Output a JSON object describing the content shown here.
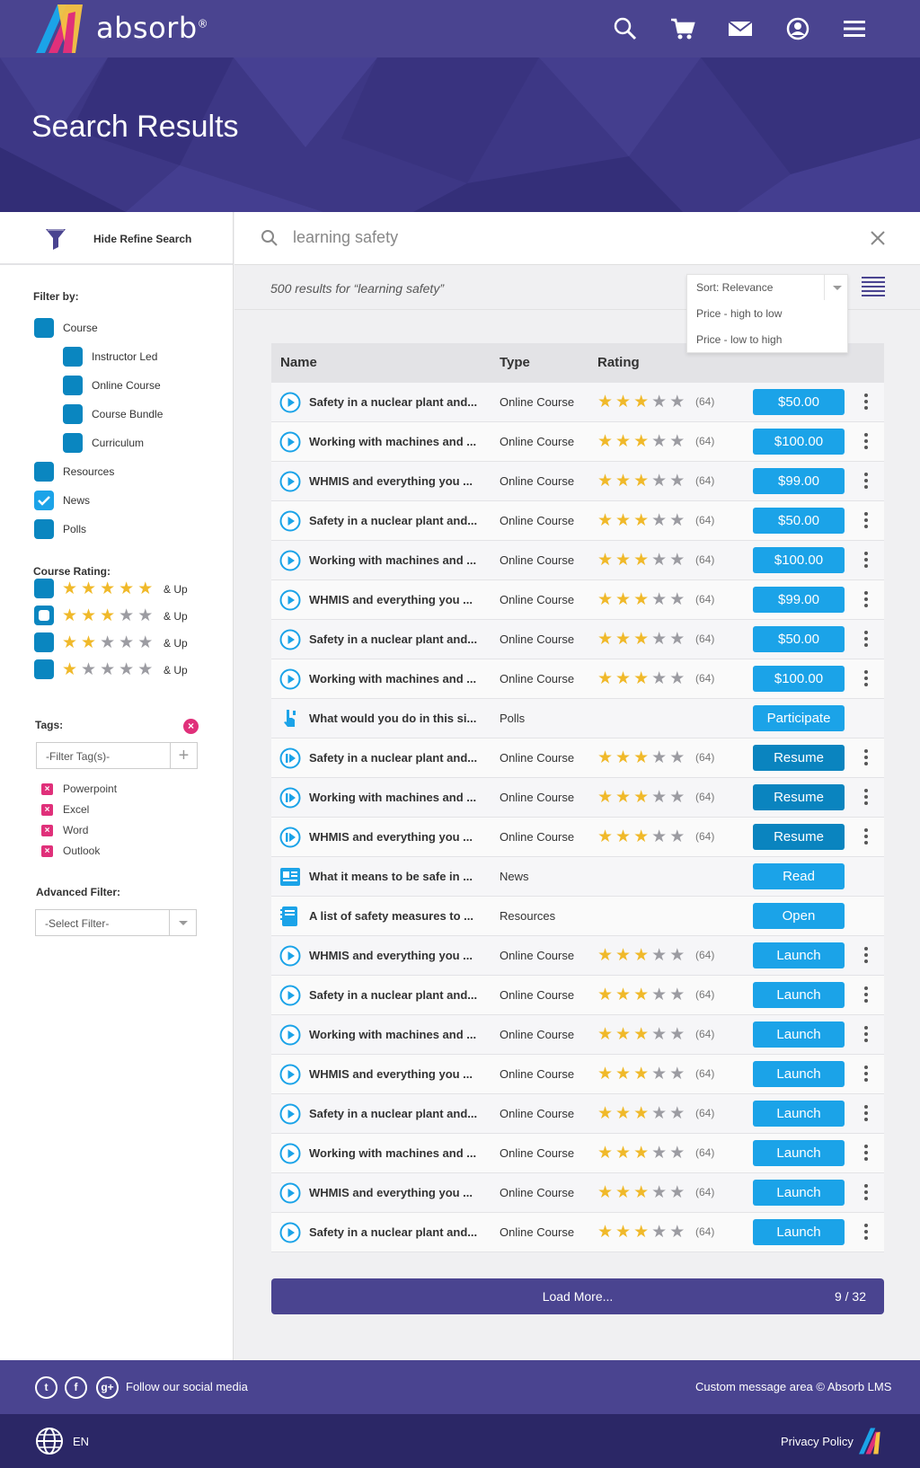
{
  "header": {
    "logo_text": "absorb",
    "logo_reg": "®"
  },
  "hero": {
    "title": "Search Results"
  },
  "sidebar": {
    "refine_label": "Hide Refine Search",
    "filter_by": "Filter by:",
    "filters": [
      {
        "label": "Course",
        "checked": false
      },
      {
        "label": "Instructor Led",
        "checked": false
      },
      {
        "label": "Online Course",
        "checked": false
      },
      {
        "label": "Course Bundle",
        "checked": false
      },
      {
        "label": "Curriculum",
        "checked": false
      },
      {
        "label": "Resources",
        "checked": false
      },
      {
        "label": "News",
        "checked": true
      },
      {
        "label": "Polls",
        "checked": false
      }
    ],
    "course_rating": "Course Rating:",
    "ratings": [
      {
        "stars": 5,
        "label": "& Up"
      },
      {
        "stars": 3,
        "label": "& Up"
      },
      {
        "stars": 2,
        "label": "& Up"
      },
      {
        "stars": 1,
        "label": "& Up"
      }
    ],
    "tags_title": "Tags:",
    "tag_placeholder": "-Filter Tag(s)-",
    "tags": [
      "Powerpoint",
      "Excel",
      "Word",
      "Outlook"
    ],
    "advanced_title": "Advanced Filter:",
    "select_placeholder": "-Select Filter-"
  },
  "search": {
    "query": "learning safety",
    "results_text": "500 results for “learning safety”"
  },
  "sort": {
    "options": [
      "Sort: Relevance",
      "Price - high to low",
      "Price - low to high"
    ]
  },
  "table": {
    "headers": [
      "Name",
      "Type",
      "Rating"
    ],
    "rows": [
      {
        "name": "Safety in a nuclear plant and...",
        "type": "Online Course",
        "stars": 3,
        "count": "(64)",
        "button": "$50.00",
        "icon": "play"
      },
      {
        "name": "Working with machines and ...",
        "type": "Online Course",
        "stars": 3,
        "count": "(64)",
        "button": "$100.00",
        "icon": "play"
      },
      {
        "name": "WHMIS and everything you ...",
        "type": "Online Course",
        "stars": 3,
        "count": "(64)",
        "button": "$99.00",
        "icon": "play"
      },
      {
        "name": "Safety in a nuclear plant and...",
        "type": "Online Course",
        "stars": 3,
        "count": "(64)",
        "button": "$50.00",
        "icon": "play"
      },
      {
        "name": "Working with machines and ...",
        "type": "Online Course",
        "stars": 3,
        "count": "(64)",
        "button": "$100.00",
        "icon": "play"
      },
      {
        "name": "WHMIS and everything you ...",
        "type": "Online Course",
        "stars": 3,
        "count": "(64)",
        "button": "$99.00",
        "icon": "play"
      },
      {
        "name": "Safety in a nuclear plant and...",
        "type": "Online Course",
        "stars": 3,
        "count": "(64)",
        "button": "$50.00",
        "icon": "play"
      },
      {
        "name": "Working with machines and ...",
        "type": "Online Course",
        "stars": 3,
        "count": "(64)",
        "button": "$100.00",
        "icon": "play"
      },
      {
        "name": "What would you do in this si...",
        "type": "Polls",
        "stars": 0,
        "count": "",
        "button": "Participate",
        "icon": "poll"
      },
      {
        "name": "Safety in a nuclear plant and...",
        "type": "Online Course",
        "stars": 3,
        "count": "(64)",
        "button": "Resume",
        "icon": "resume"
      },
      {
        "name": "Working with machines and ...",
        "type": "Online Course",
        "stars": 3,
        "count": "(64)",
        "button": "Resume",
        "icon": "resume"
      },
      {
        "name": "WHMIS and everything you ...",
        "type": "Online Course",
        "stars": 3,
        "count": "(64)",
        "button": "Resume",
        "icon": "resume"
      },
      {
        "name": "What it means to be safe in ...",
        "type": "News",
        "stars": 0,
        "count": "",
        "button": "Read",
        "icon": "news"
      },
      {
        "name": "A list of safety measures to ...",
        "type": "Resources",
        "stars": 0,
        "count": "",
        "button": "Open",
        "icon": "resource"
      },
      {
        "name": "WHMIS and everything you ...",
        "type": "Online Course",
        "stars": 3,
        "count": "(64)",
        "button": "Launch",
        "icon": "play"
      },
      {
        "name": "Safety in a nuclear plant and...",
        "type": "Online Course",
        "stars": 3,
        "count": "(64)",
        "button": "Launch",
        "icon": "play"
      },
      {
        "name": "Working with machines and ...",
        "type": "Online Course",
        "stars": 3,
        "count": "(64)",
        "button": "Launch",
        "icon": "play"
      },
      {
        "name": "WHMIS and everything you ...",
        "type": "Online Course",
        "stars": 3,
        "count": "(64)",
        "button": "Launch",
        "icon": "play"
      },
      {
        "name": "Safety in a nuclear plant and...",
        "type": "Online Course",
        "stars": 3,
        "count": "(64)",
        "button": "Launch",
        "icon": "play"
      },
      {
        "name": "Working with machines and ...",
        "type": "Online Course",
        "stars": 3,
        "count": "(64)",
        "button": "Launch",
        "icon": "play"
      },
      {
        "name": "WHMIS and everything you ...",
        "type": "Online Course",
        "stars": 3,
        "count": "(64)",
        "button": "Launch",
        "icon": "play"
      },
      {
        "name": "Safety in a nuclear plant and...",
        "type": "Online Course",
        "stars": 3,
        "count": "(64)",
        "button": "Launch",
        "icon": "play"
      }
    ]
  },
  "load_more": {
    "label": "Load More...",
    "count": "9 / 32"
  },
  "footer": {
    "social_text": "Follow our social media",
    "custom_message": "Custom message area © Absorb LMS",
    "language": "EN",
    "privacy": "Privacy Policy"
  },
  "colors": {
    "primary": "#4a4490",
    "accent": "#1ba3e8",
    "dark_accent": "#0a84bf",
    "star": "#f0b92a",
    "tag_remove": "#e0307a"
  }
}
